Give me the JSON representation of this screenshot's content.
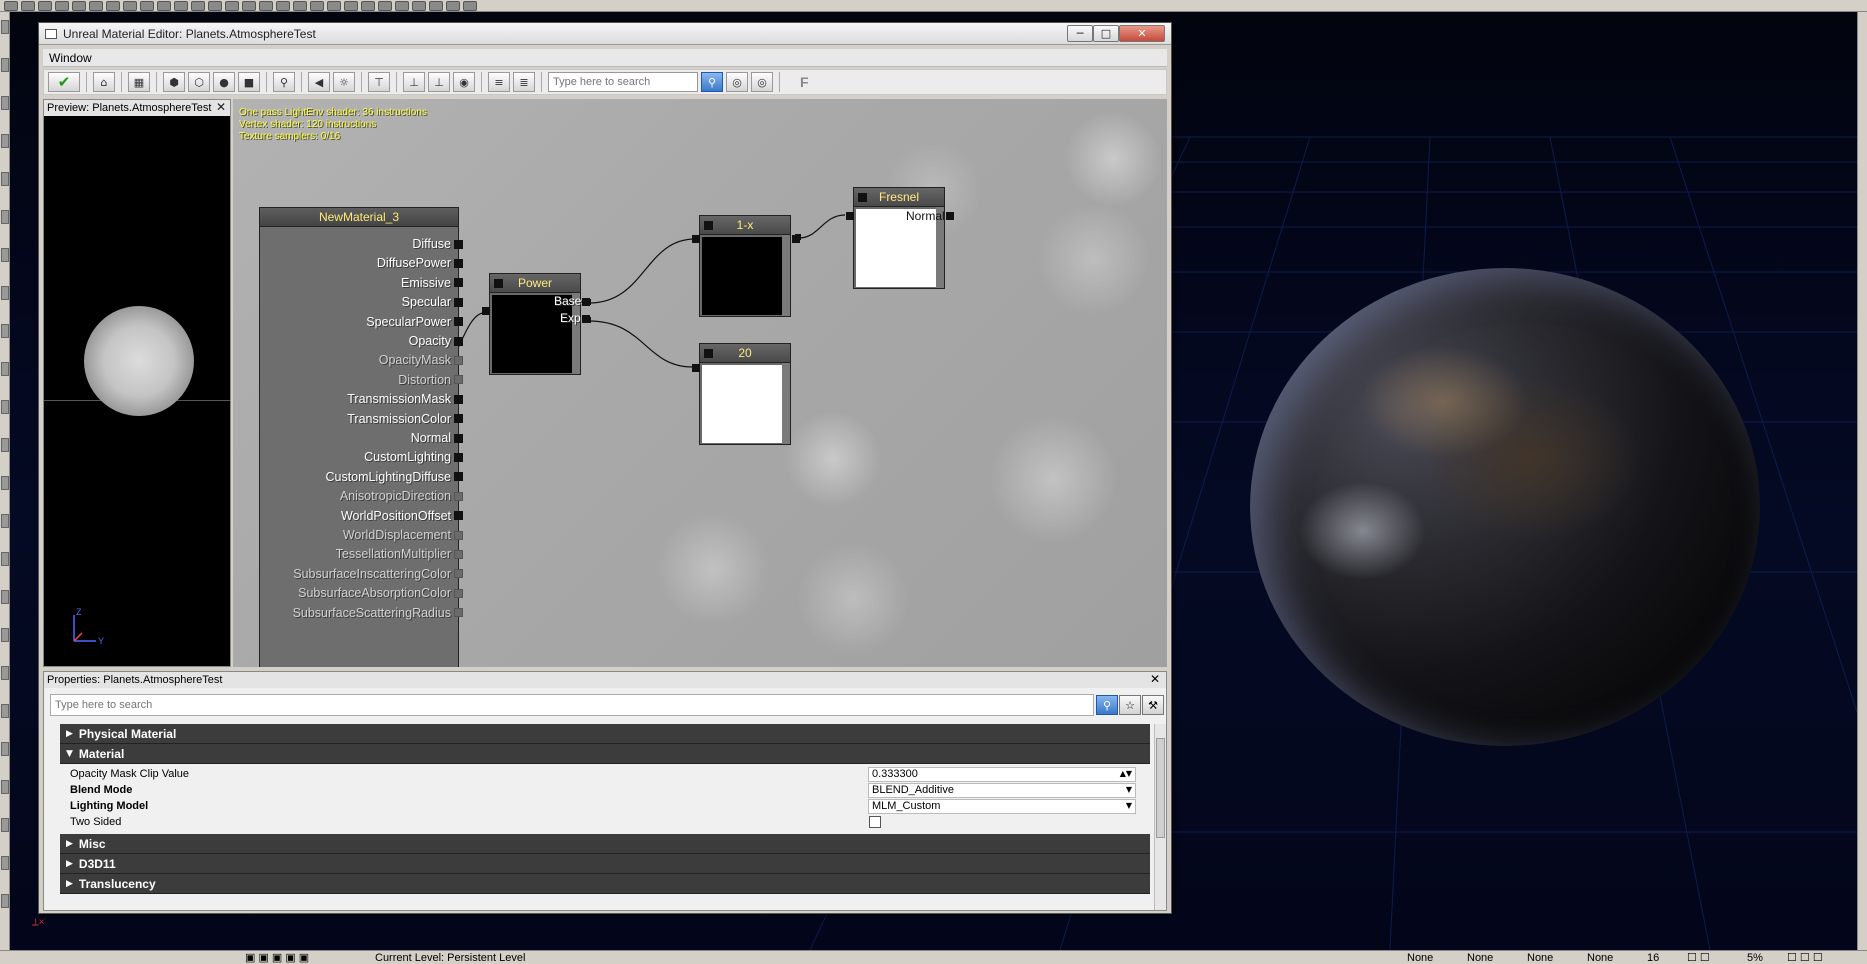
{
  "window": {
    "title": "Unreal Material Editor: Planets.AtmosphereTest",
    "min": "─",
    "max": "□",
    "close": "✕"
  },
  "menu": {
    "window": "Window"
  },
  "toolbar": {
    "apply_icon": "✔",
    "search_placeholder": "Type here to search",
    "f_label": "F",
    "icons": [
      "home-icon",
      "grid-icon",
      "cube-icon",
      "cylinder-icon",
      "sphere-icon",
      "plane-icon",
      "zoom-icon",
      "back-icon",
      "bulb-icon",
      "connector-icon",
      "find-icon",
      "eye-icon",
      "list-icon",
      "hlsl-icon"
    ]
  },
  "preview": {
    "title": "Preview: Planets.AtmosphereTest",
    "close": "✕",
    "axis_z": "Z",
    "axis_y": "Y"
  },
  "stats": {
    "line1": "One pass LightEnv shader: 36 instructions",
    "line2": "Vertex shader: 120 instructions",
    "line3": "Texture samplers: 0/16"
  },
  "material_node": {
    "title": "NewMaterial_3",
    "inputs": [
      {
        "label": "Diffuse",
        "active": true
      },
      {
        "label": "DiffusePower",
        "active": true
      },
      {
        "label": "Emissive",
        "active": true
      },
      {
        "label": "Specular",
        "active": true
      },
      {
        "label": "SpecularPower",
        "active": true
      },
      {
        "label": "Opacity",
        "active": true
      },
      {
        "label": "OpacityMask",
        "active": false
      },
      {
        "label": "Distortion",
        "active": false
      },
      {
        "label": "TransmissionMask",
        "active": true
      },
      {
        "label": "TransmissionColor",
        "active": true
      },
      {
        "label": "Normal",
        "active": true
      },
      {
        "label": "CustomLighting",
        "active": true
      },
      {
        "label": "CustomLightingDiffuse",
        "active": true
      },
      {
        "label": "AnisotropicDirection",
        "active": false
      },
      {
        "label": "WorldPositionOffset",
        "active": true
      },
      {
        "label": "WorldDisplacement",
        "active": false
      },
      {
        "label": "TessellationMultiplier",
        "active": false
      },
      {
        "label": "SubsurfaceInscatteringColor",
        "active": false
      },
      {
        "label": "SubsurfaceAbsorptionColor",
        "active": false
      },
      {
        "label": "SubsurfaceScatteringRadius",
        "active": false
      }
    ]
  },
  "nodes": {
    "power": {
      "title": "Power",
      "base": "Base",
      "exp": "Exp",
      "swatch": "#000000"
    },
    "one_minus": {
      "title": "1-x",
      "swatch": "#000000"
    },
    "fresnel": {
      "title": "Fresnel",
      "normal": "Normal",
      "swatch": "#ffffff"
    },
    "constant": {
      "title": "20",
      "swatch": "#ffffff"
    }
  },
  "properties": {
    "title": "Properties: Planets.AtmosphereTest",
    "close": "✕",
    "search_placeholder": "Type here to search",
    "categories": {
      "physical_material": "Physical Material",
      "material": "Material",
      "misc": "Misc",
      "d3d11": "D3D11",
      "translucency": "Translucency"
    },
    "rows": {
      "opacity_mask_clip": {
        "label": "Opacity Mask Clip Value",
        "value": "0.333300"
      },
      "blend_mode": {
        "label": "Blend Mode",
        "value": "BLEND_Additive"
      },
      "lighting_model": {
        "label": "Lighting Model",
        "value": "MLM_Custom"
      },
      "two_sided": {
        "label": "Two Sided",
        "checked": false
      }
    }
  },
  "statusbar": {
    "current_level": "Current Level:  Persistent Level",
    "fields": [
      "None",
      "None",
      "None",
      "None"
    ],
    "grid": "16",
    "snap": "5%"
  },
  "colors": {
    "node_title": "#ffe97a",
    "stats_text": "#ffff3c",
    "graph_bg": "#a9a9a9",
    "category_bg": "#3c3c3c"
  }
}
